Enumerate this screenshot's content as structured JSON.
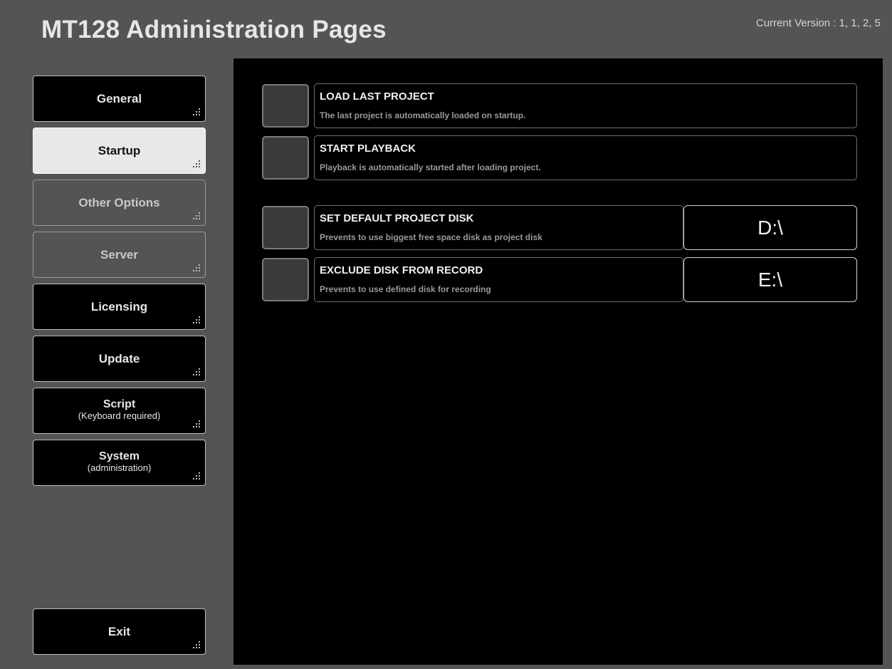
{
  "header": {
    "title": "MT128 Administration Pages",
    "version_label": "Current Version :",
    "version_value": "1, 1, 2, 5"
  },
  "sidebar": {
    "items": [
      {
        "label": "General",
        "state": "normal"
      },
      {
        "label": "Startup",
        "state": "active"
      },
      {
        "label": "Other Options",
        "state": "disabled"
      },
      {
        "label": "Server",
        "state": "disabled"
      },
      {
        "label": "Licensing",
        "state": "normal"
      },
      {
        "label": "Update",
        "state": "normal"
      },
      {
        "label": "Script",
        "sublabel": "(Keyboard required)",
        "state": "normal"
      },
      {
        "label": "System",
        "sublabel": "(administration)",
        "state": "normal"
      }
    ],
    "exit_label": "Exit"
  },
  "options": [
    {
      "title": "LOAD LAST PROJECT",
      "description": "The last project is automatically loaded on startup."
    },
    {
      "title": "START PLAYBACK",
      "description": "Playback is automatically started after loading project."
    },
    {
      "title": "SET DEFAULT PROJECT DISK",
      "description": "Prevents to use biggest free space disk as project disk",
      "disk": "D:\\"
    },
    {
      "title": "EXCLUDE DISK FROM RECORD",
      "description": "Prevents to use defined disk for recording",
      "disk": "E:\\"
    }
  ],
  "colors": {
    "frame_gray": "#545454",
    "content_bg": "#000000",
    "active_button": "#e8e8e8"
  },
  "icons": {
    "nav_corner": "grip-dots-icon"
  }
}
